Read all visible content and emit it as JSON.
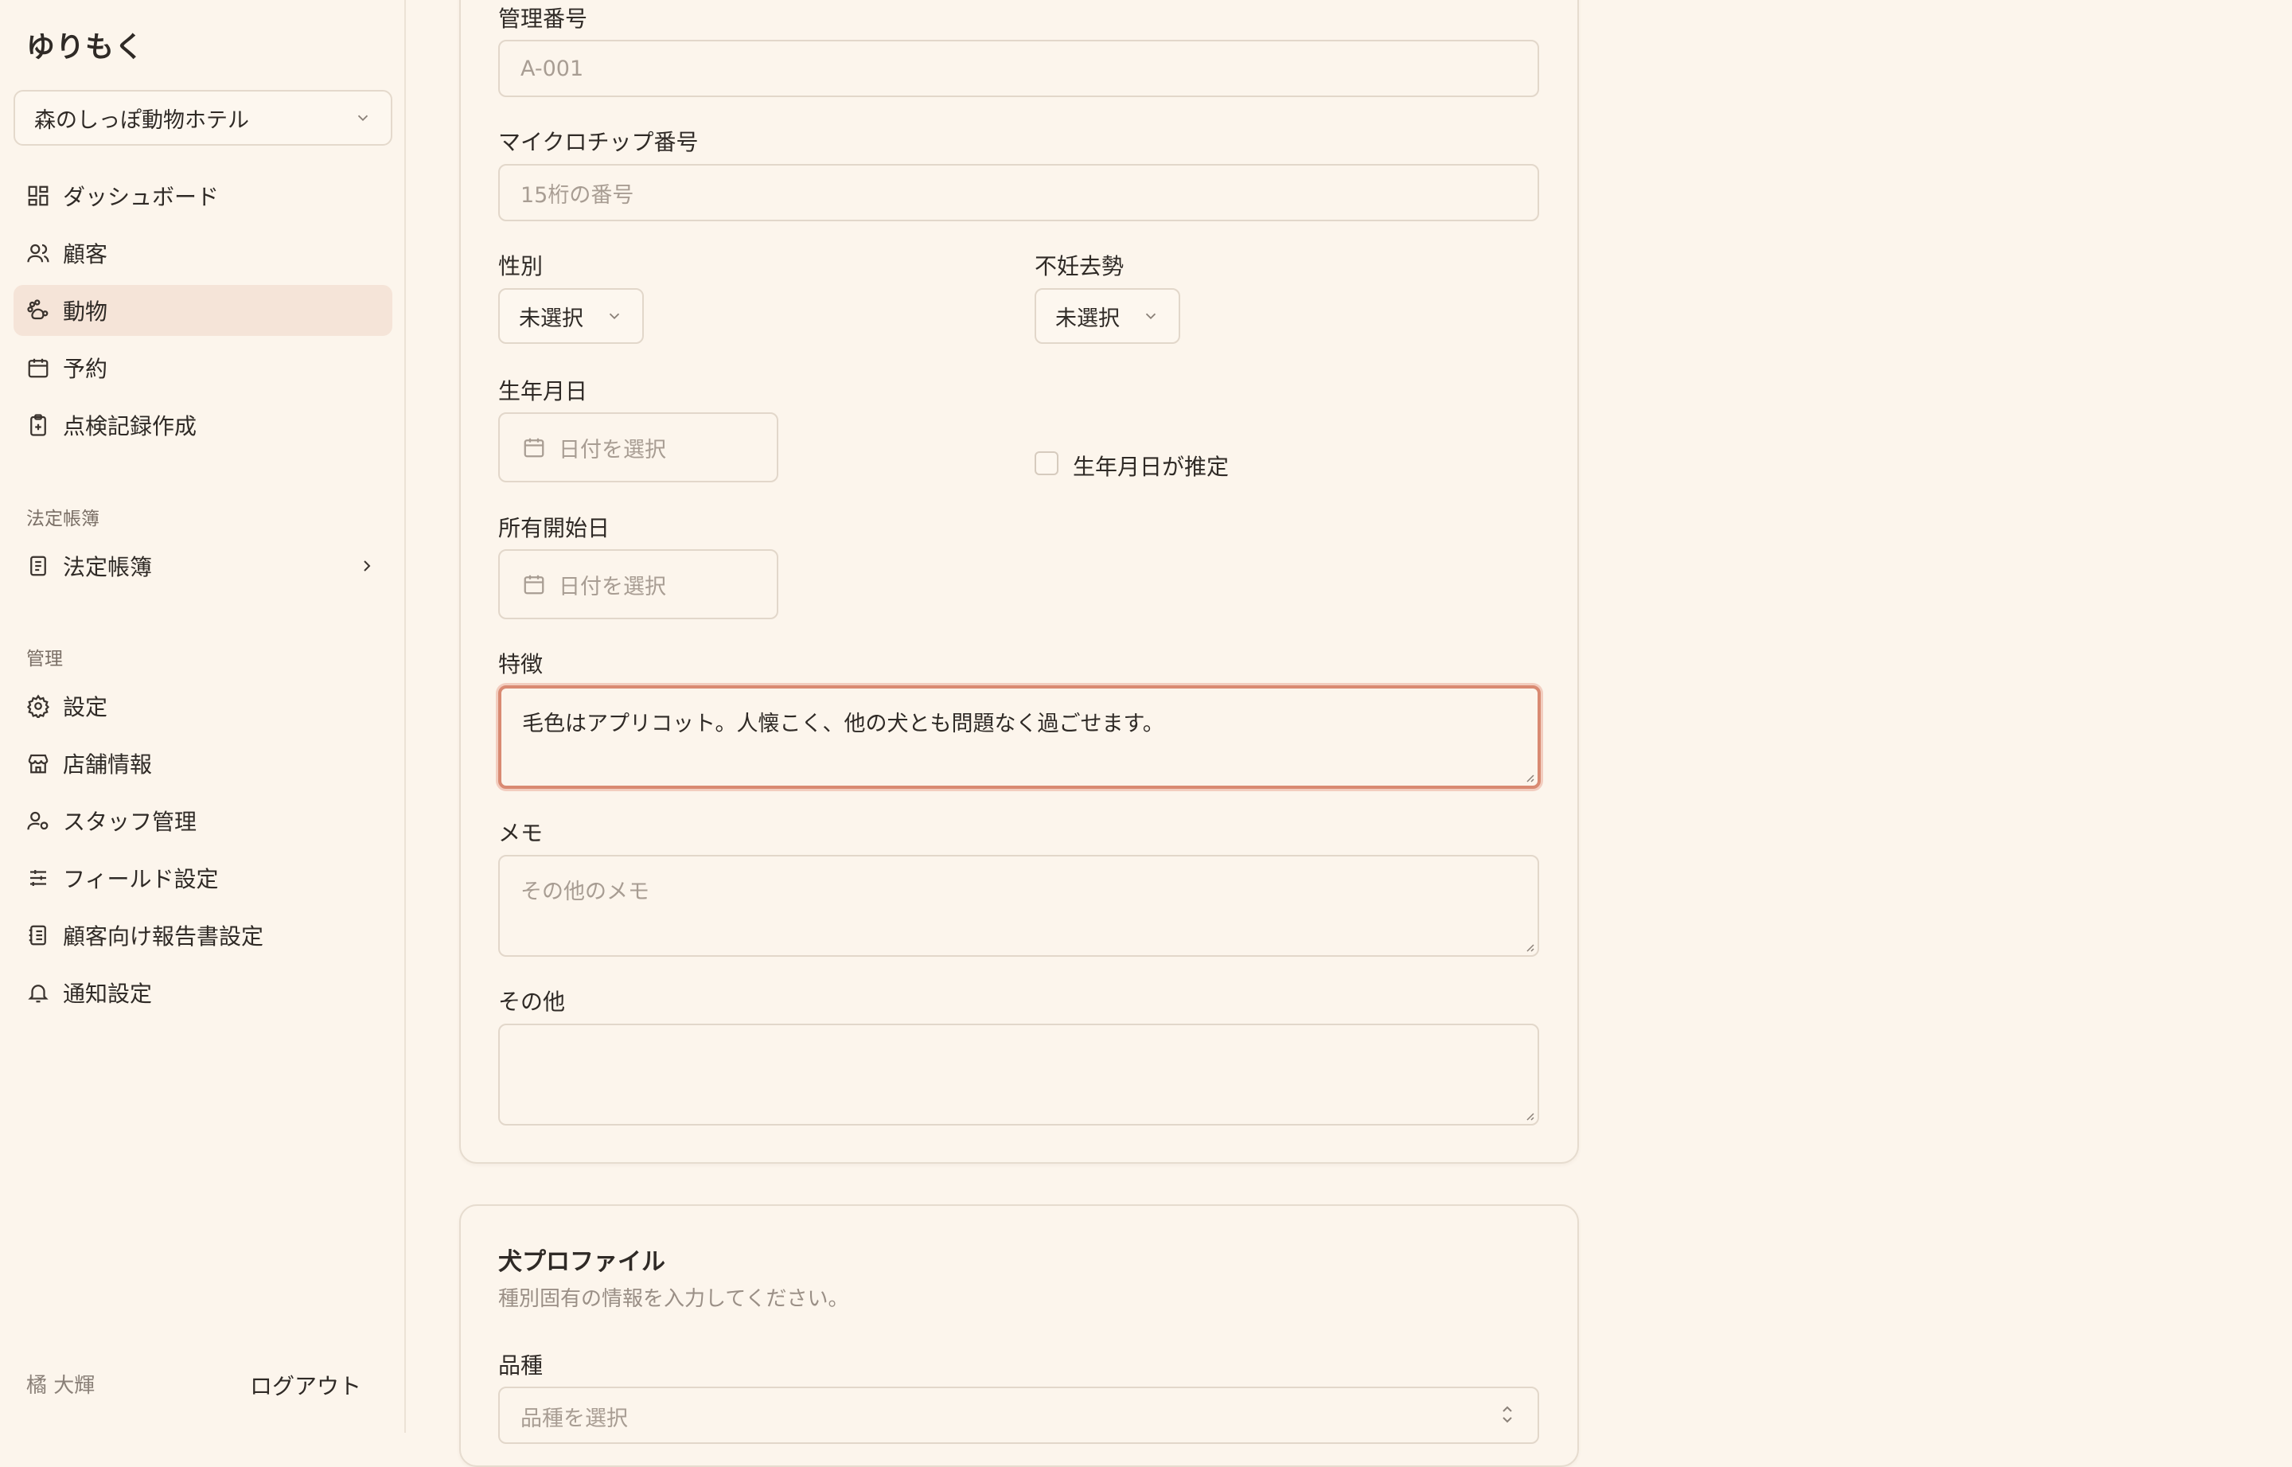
{
  "app": {
    "brand": "ゆりもく"
  },
  "sidebar": {
    "store": "森のしっぽ動物ホテル",
    "items": [
      {
        "label": "ダッシュボード"
      },
      {
        "label": "顧客"
      },
      {
        "label": "動物"
      },
      {
        "label": "予約"
      },
      {
        "label": "点検記録作成"
      }
    ],
    "legal_section": "法定帳簿",
    "legal_item": "法定帳簿",
    "admin_section": "管理",
    "admin_items": [
      {
        "label": "設定"
      },
      {
        "label": "店舗情報"
      },
      {
        "label": "スタッフ管理"
      },
      {
        "label": "フィールド設定"
      },
      {
        "label": "顧客向け報告書設定"
      },
      {
        "label": "通知設定"
      }
    ],
    "user_name": "橘 大輝",
    "logout": "ログアウト"
  },
  "form": {
    "mgmt_number": {
      "label": "管理番号",
      "placeholder": "A-001"
    },
    "microchip": {
      "label": "マイクロチップ番号",
      "placeholder": "15桁の番号"
    },
    "sex": {
      "label": "性別",
      "value": "未選択"
    },
    "neuter": {
      "label": "不妊去勢",
      "value": "未選択"
    },
    "birthdate": {
      "label": "生年月日",
      "placeholder": "日付を選択"
    },
    "birthdate_estimated": {
      "label": "生年月日が推定",
      "checked": false
    },
    "ownership_start": {
      "label": "所有開始日",
      "placeholder": "日付を選択"
    },
    "features": {
      "label": "特徴",
      "value": "毛色はアプリコット。人懐こく、他の犬とも問題なく過ごせます。"
    },
    "memo": {
      "label": "メモ",
      "placeholder": "その他のメモ"
    },
    "other": {
      "label": "その他",
      "value": ""
    }
  },
  "dog_profile": {
    "title": "犬プロファイル",
    "subtitle": "種別固有の情報を入力してください。",
    "breed": {
      "label": "品種",
      "placeholder": "品種を選択"
    }
  },
  "colors": {
    "accent": "#d98a72",
    "active_nav": "#f5e4d8",
    "background": "#fcf5ec"
  }
}
